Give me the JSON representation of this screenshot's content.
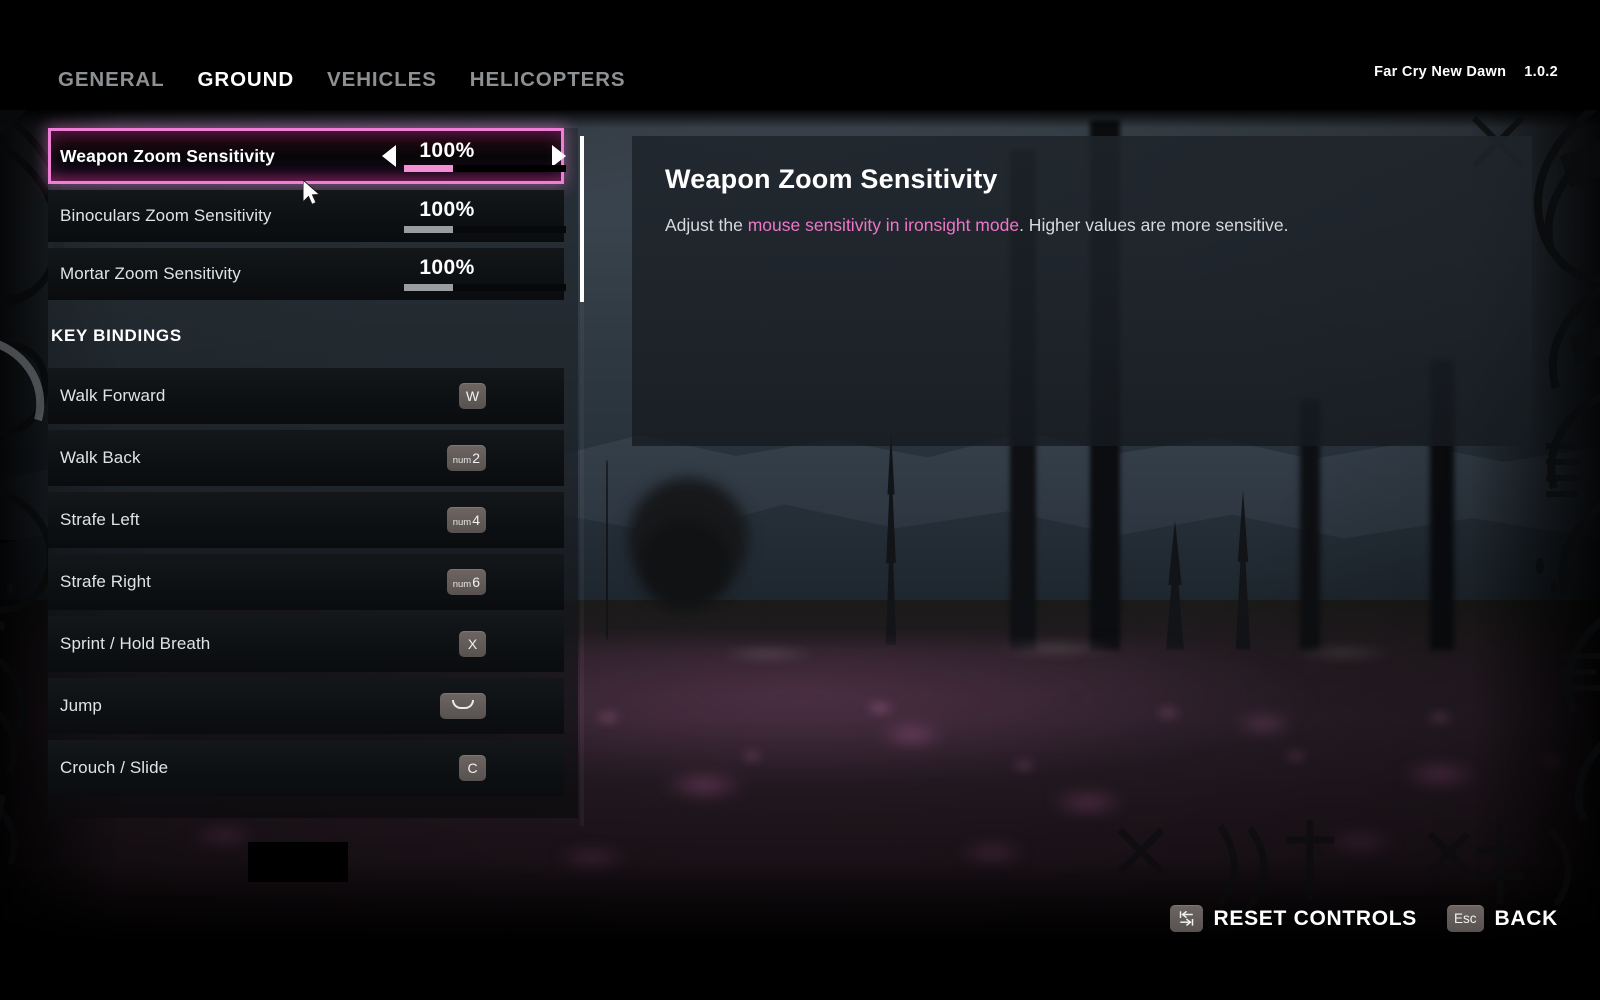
{
  "header": {
    "tabs": [
      {
        "label": "GENERAL",
        "active": false
      },
      {
        "label": "GROUND",
        "active": true
      },
      {
        "label": "VEHICLES",
        "active": false
      },
      {
        "label": "HELICOPTERS",
        "active": false
      }
    ],
    "game_title": "Far Cry New Dawn",
    "version": "1.0.2"
  },
  "settings": {
    "sliders": [
      {
        "label": "Weapon Zoom Sensitivity",
        "value": "100%",
        "fill_percent": 30,
        "selected": true
      },
      {
        "label": "Binoculars Zoom Sensitivity",
        "value": "100%",
        "fill_percent": 30,
        "selected": false
      },
      {
        "label": "Mortar Zoom Sensitivity",
        "value": "100%",
        "fill_percent": 30,
        "selected": false
      }
    ],
    "section_heading": "KEY BINDINGS",
    "bindings": [
      {
        "action": "Walk Forward",
        "key": "W",
        "prefix": "",
        "type": "letter"
      },
      {
        "action": "Walk Back",
        "key": "2",
        "prefix": "num",
        "type": "numpad"
      },
      {
        "action": "Strafe Left",
        "key": "4",
        "prefix": "num",
        "type": "numpad"
      },
      {
        "action": "Strafe Right",
        "key": "6",
        "prefix": "num",
        "type": "numpad"
      },
      {
        "action": "Sprint / Hold Breath",
        "key": "X",
        "prefix": "",
        "type": "letter"
      },
      {
        "action": "Jump",
        "key": "",
        "prefix": "",
        "type": "spacebar"
      },
      {
        "action": "Crouch / Slide",
        "key": "C",
        "prefix": "",
        "type": "letter"
      }
    ]
  },
  "description": {
    "title": "Weapon Zoom Sensitivity",
    "text_before": "Adjust the ",
    "text_highlight": "mouse sensitivity in ironsight mode",
    "text_after": ". Higher values are more sensitive."
  },
  "footer": {
    "reset": {
      "key": "tab-icon",
      "label": "RESET CONTROLS"
    },
    "back": {
      "key": "Esc",
      "label": "BACK"
    }
  },
  "colors": {
    "accent_pink": "#ef7fd6",
    "highlight_text_pink": "#ee76c8",
    "selected_border": "#ef7fd6",
    "slider_fill_inactive": "#9a9d9f",
    "slider_fill_active": "#f58fd3",
    "tab_active": "#ffffff",
    "tab_inactive": "#8e9194",
    "key_badge": "#5f5956"
  },
  "scrollbar": {
    "thumb_top_percent": 0,
    "thumb_height_percent": 24
  }
}
